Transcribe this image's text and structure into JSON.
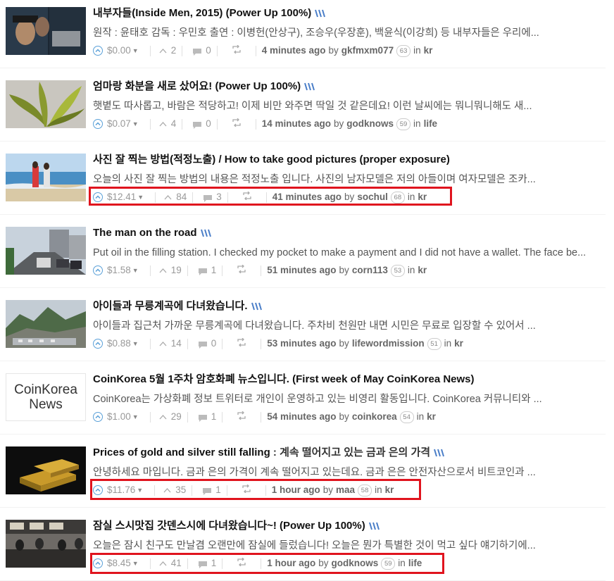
{
  "colors": {
    "highlight": "#e0141e",
    "upvote": "#5aa0d8"
  },
  "posts": [
    {
      "title": "내부자들(Inside Men, 2015) (Power Up 100%)",
      "body": "원작 : 윤태호 감독 : 우민호 출연 : 이병헌(안상구), 조승우(우장훈), 백윤식(이강희) 등 내부자들은 우리에...",
      "payout": "$0.00",
      "votes": "2",
      "comments": "0",
      "time": "4 minutes ago",
      "by": "by",
      "author": "gkfmxm077",
      "rep": "63",
      "in": "in",
      "category": "kr",
      "thumb": "movie-poster",
      "highlighted": false
    },
    {
      "title": "엄마랑 화분을 새로 샀어요! (Power Up 100%)",
      "body": "햇볕도 따사롭고, 바람은 적당하고! 이제 비만 와주면 딱일 것 같은데요! 이런 날씨에는 뭐니뭐니해도 새...",
      "payout": "$0.07",
      "votes": "4",
      "comments": "0",
      "time": "14 minutes ago",
      "by": "by",
      "author": "godknows",
      "rep": "59",
      "in": "in",
      "category": "life",
      "thumb": "plant",
      "highlighted": false
    },
    {
      "title": "사진 잘 찍는 방법(적정노출) / How to take good pictures (proper exposure)",
      "body": "오늘의 사진 잘 찍는 방법의 내용은 적정노출 입니다. 사진의 남자모델은 저의 아들이며 여자모델은 조카...",
      "payout": "$12.41",
      "votes": "84",
      "comments": "3",
      "time": "41 minutes ago",
      "by": "by",
      "author": "sochul",
      "rep": "68",
      "in": "in",
      "category": "kr",
      "thumb": "beach",
      "highlighted": true
    },
    {
      "title": "The man on the road",
      "body": "Put oil in the filling station. I checked my pocket to make a payment and I did not have a wallet. The face be...",
      "payout": "$1.58",
      "votes": "19",
      "comments": "1",
      "time": "51 minutes ago",
      "by": "by",
      "author": "corn113",
      "rep": "53",
      "in": "in",
      "category": "kr",
      "thumb": "road",
      "highlighted": false
    },
    {
      "title": "아이들과 무릉계곡에 다녀왔습니다.",
      "body": "아이들과 집근처 가까운 무릉계곡에 다녀왔습니다. 주차비 천원만 내면 시민은 무료로 입장할 수 있어서 ...",
      "payout": "$0.88",
      "votes": "14",
      "comments": "0",
      "time": "53 minutes ago",
      "by": "by",
      "author": "lifewordmission",
      "rep": "51",
      "in": "in",
      "category": "kr",
      "thumb": "valley",
      "highlighted": false
    },
    {
      "title": "CoinKorea 5월 1주차 암호화폐 뉴스입니다. (First week of May CoinKorea News)",
      "body": "CoinKorea는 가상화폐 정보 트위터로 개인이 운영하고 있는 비영리 활동입니다. CoinKorea 커뮤니티와 ...",
      "payout": "$1.00",
      "votes": "29",
      "comments": "1",
      "time": "54 minutes ago",
      "by": "by",
      "author": "coinkorea",
      "rep": "54",
      "in": "in",
      "category": "kr",
      "thumb": "coinkorea",
      "thumb_text": [
        "CoinKorea",
        "News"
      ],
      "highlighted": false
    },
    {
      "title": "Prices of gold and silver still falling",
      "title_suffix": " : 계속 떨어지고 있는 금과 은의 가격",
      "body": "안녕하세요 마입니다. 금과 은의 가격이 계속 떨어지고 있는데요. 금과 은은 안전자산으로서 비트코인과 ...",
      "payout": "$11.76",
      "votes": "35",
      "comments": "1",
      "time": "1 hour ago",
      "by": "by",
      "author": "maa",
      "rep": "58",
      "in": "in",
      "category": "kr",
      "thumb": "gold",
      "highlighted": true
    },
    {
      "title": "잠실 스시맛집 갓덴스시에 다녀왔습니다~! (Power Up 100%)",
      "body": "오늘은 잠시 친구도 만날겸 오랜만에 잠실에 들렀습니다! 오늘은 뭔가 특별한 것이 먹고 싶다 얘기하기에...",
      "payout": "$8.45",
      "votes": "41",
      "comments": "1",
      "time": "1 hour ago",
      "by": "by",
      "author": "godknows",
      "rep": "59",
      "in": "in",
      "category": "life",
      "thumb": "sushi",
      "highlighted": true
    }
  ]
}
